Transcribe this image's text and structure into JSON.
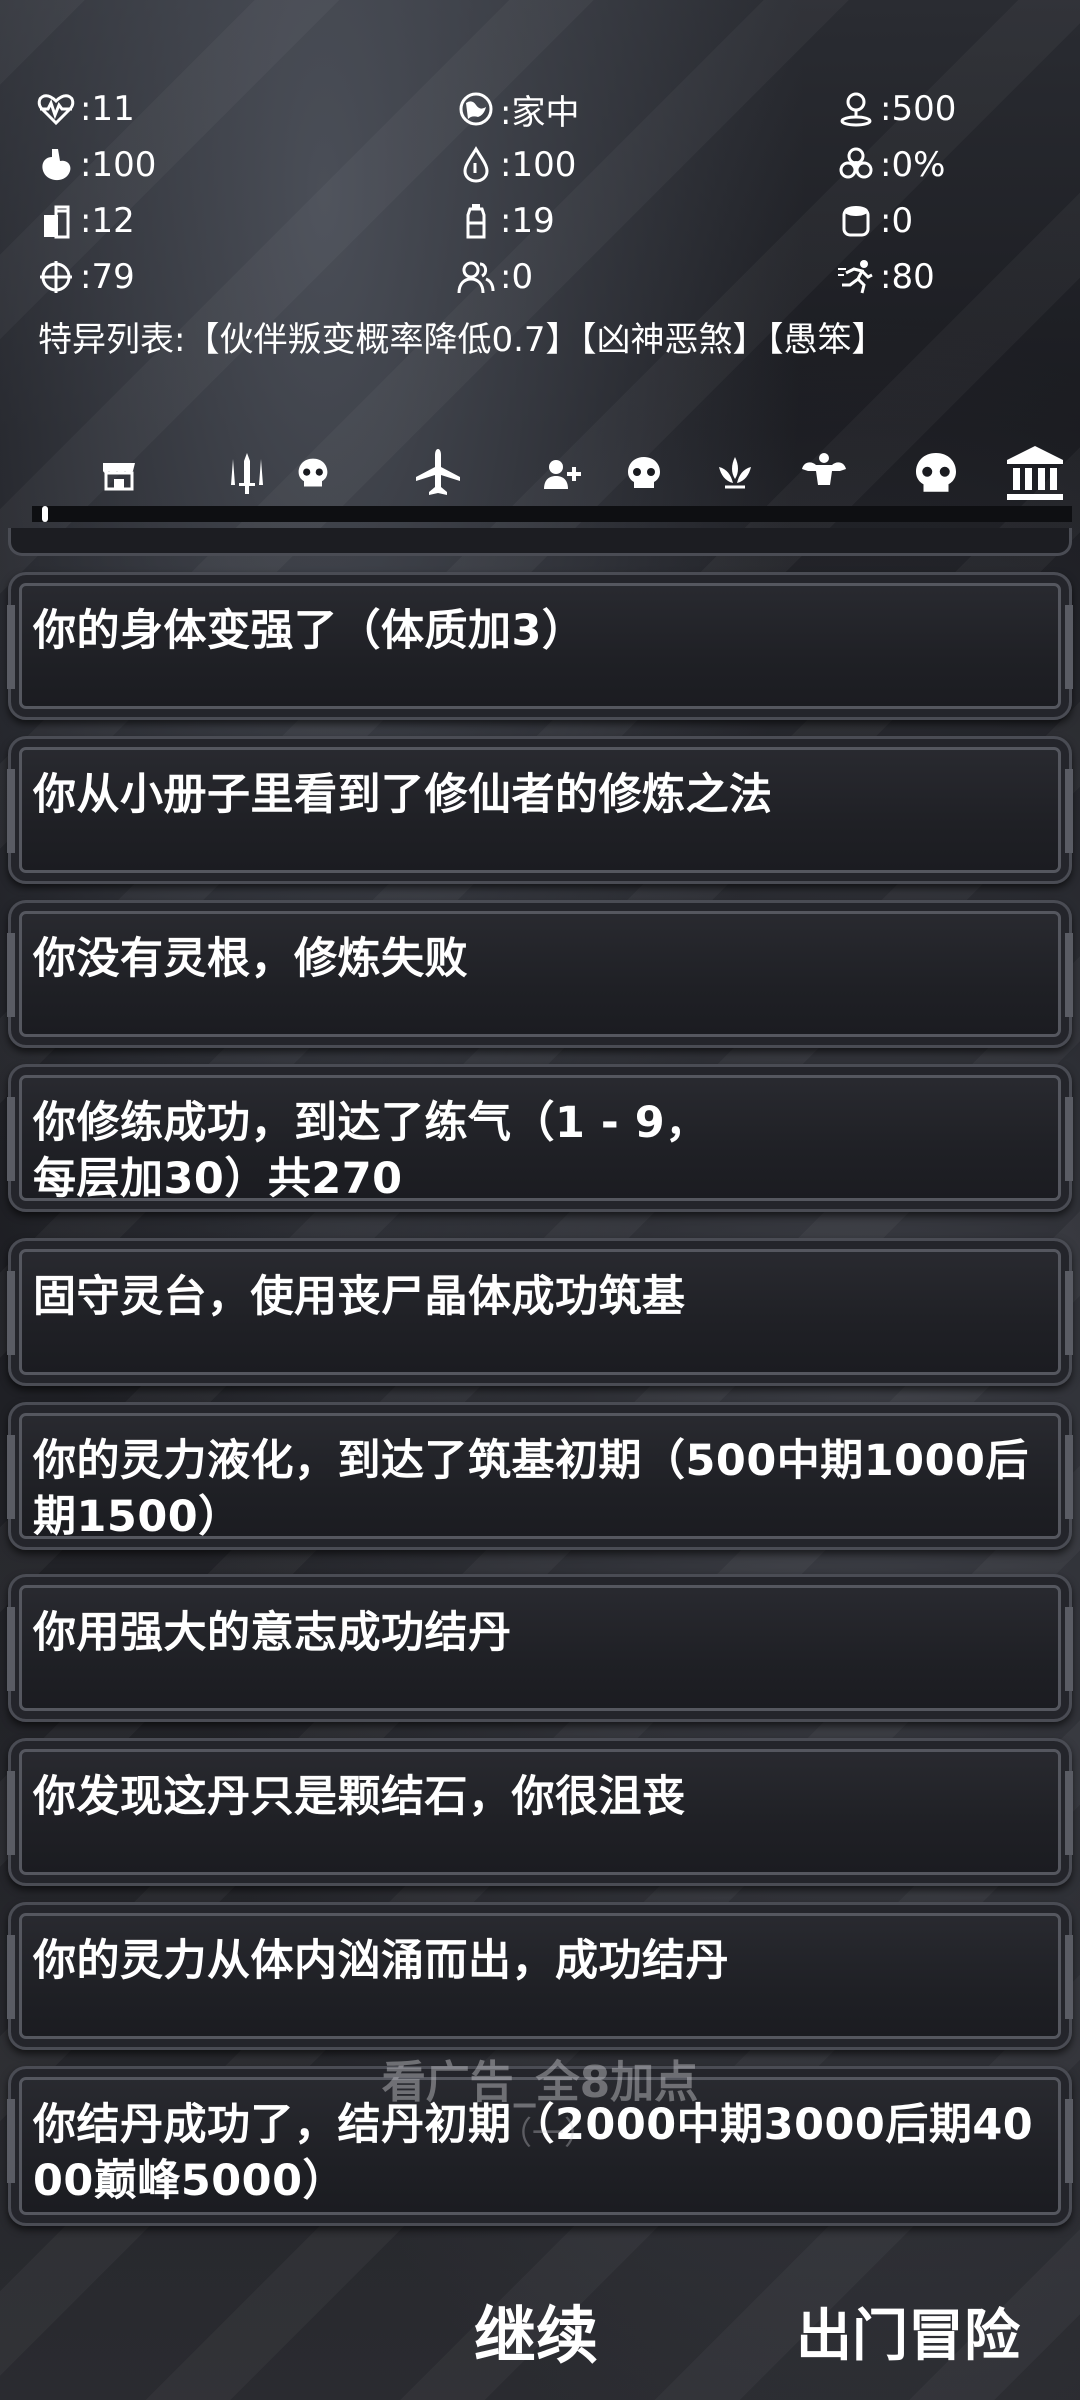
{
  "stats": [
    {
      "icon": "heartbeat-icon",
      "value": ":11"
    },
    {
      "icon": "globe-location-icon",
      "value": ":家中"
    },
    {
      "icon": "map-pin-icon",
      "value": ":500"
    },
    {
      "icon": "stomach-icon",
      "value": ":100"
    },
    {
      "icon": "water-drop-icon",
      "value": ":100"
    },
    {
      "icon": "biohazard-icon",
      "value": ":0%"
    },
    {
      "icon": "food-can-icon",
      "value": ":12"
    },
    {
      "icon": "water-bottle-icon",
      "value": ":19"
    },
    {
      "icon": "toilet-paper-icon",
      "value": ":0"
    },
    {
      "icon": "crosshair-icon",
      "value": ":79"
    },
    {
      "icon": "users-icon",
      "value": ":0"
    },
    {
      "icon": "running-icon",
      "value": ":80"
    }
  ],
  "special_traits": "特异列表:【伙伴叛变概率降低0.7】【凶神恶煞】【愚笨】",
  "tabs": [
    {
      "icon": "shop-icon"
    },
    {
      "icon": "weapons-icon"
    },
    {
      "icon": "skull-small-icon"
    },
    {
      "icon": "airplane-icon"
    },
    {
      "icon": "add-user-icon"
    },
    {
      "icon": "skull-icon"
    },
    {
      "icon": "lotus-icon"
    },
    {
      "icon": "muscle-icon"
    },
    {
      "icon": "skull-large-icon"
    },
    {
      "icon": "bank-icon"
    }
  ],
  "log": [
    "你的身体变强了（体质加3）",
    "你从小册子里看到了修仙者的修炼之法",
    "你没有灵根，修炼失败",
    "你修练成功，到达了练气（1 - 9，每层加30）共270",
    "固守灵台，使用丧尸晶体成功筑基",
    "你的灵力液化，到达了筑基初期（500中期1000后期1500）",
    "你用强大的意志成功结丹",
    "你发现这丹只是颗结石，你很沮丧",
    "你的灵力从体内汹涌而出，成功结丹",
    "你结丹成功了，结丹初期（2000中期3000后期4000巅峰5000）"
  ],
  "ad_overlay": "看广告_全8加点",
  "ad_overlay_sub": "（一）",
  "buttons": {
    "continue": "继续",
    "go_out": "出门冒险"
  }
}
